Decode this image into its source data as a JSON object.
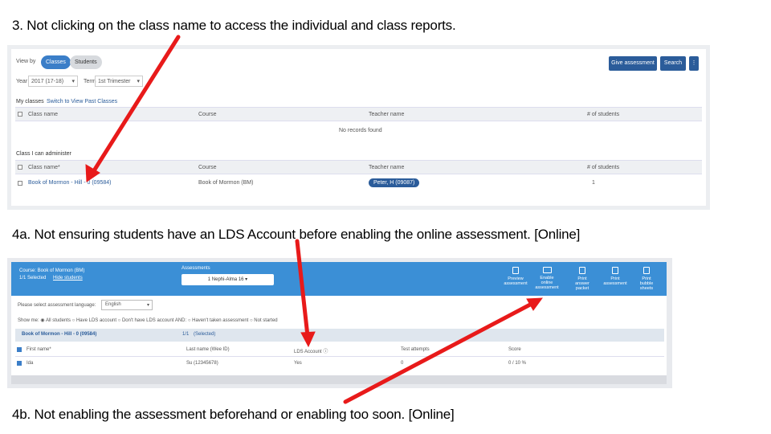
{
  "captions": {
    "c3": "3. Not clicking on the class name to access the individual and class reports.",
    "c4a": "4a. Not ensuring students have an LDS Account before enabling the online assessment. [Online]",
    "c4b": "4b. Not enabling the assessment beforehand or enabling too soon. [Online]"
  },
  "shot1": {
    "view_by_label": "View by",
    "tab_classes": "Classes",
    "tab_students": "Students",
    "give_assessment": "Give assessment",
    "search": "Search",
    "menu_glyph": "⋮",
    "year_label": "Year",
    "year_value": "2017 (17-18)",
    "term_label": "Term",
    "term_value": "1st Trimester",
    "my_classes": "My classes",
    "switch_past": "Switch to View Past Classes",
    "headers": [
      "Class name",
      "Course",
      "Teacher name",
      "# of students"
    ],
    "no_records": "No records found",
    "admin_title": "Class I can administer",
    "admin_headers": [
      "Class name*",
      "Course",
      "Teacher name",
      "# of students"
    ],
    "row": {
      "class_name": "Book of Mormon - Hill - 0 (09584)",
      "course": "Book of Mormon (BM)",
      "teacher": "Peter, H (09087)",
      "students": "1"
    }
  },
  "shot2": {
    "course_label": "Course: Book of Mormon (BM)",
    "selected": "1/1 Selected",
    "hide_students": "Hide students",
    "assessments_label": "Assessments",
    "assessment_value": "1 Nephi-Alma 16",
    "tools": [
      {
        "l1": "Preview",
        "l2": "assessment"
      },
      {
        "l1": "Enable",
        "l2": "online assessment"
      },
      {
        "l1": "Print",
        "l2": "answer packet"
      },
      {
        "l1": "Print",
        "l2": "assessment"
      },
      {
        "l1": "Print",
        "l2": "bubble sheets"
      }
    ],
    "lang_label": "Please select assessment language:",
    "lang_value": "English",
    "show_me": "Show me:",
    "filters": [
      "All students",
      "Have LDS account",
      "Don't have LDS account",
      "AND:",
      "Haven't taken assessment",
      "Not started"
    ],
    "class_row": "Book of Mormon - Hill - 0 (09584)",
    "class_count": "1/1",
    "class_select": "(Selected)",
    "headers": [
      "First name*",
      "Last name (Wee ID)",
      "LDS Account ⓘ",
      "Test attempts",
      "Score"
    ],
    "student": {
      "first": "Ida",
      "last": "Su (12345678)",
      "lds": "Yes",
      "attempts": "0",
      "score": "0 / 10 %"
    }
  },
  "colors": {
    "arrow": "#e81a1a",
    "accent": "#2b5c9a",
    "bar": "#3b8fd6"
  }
}
